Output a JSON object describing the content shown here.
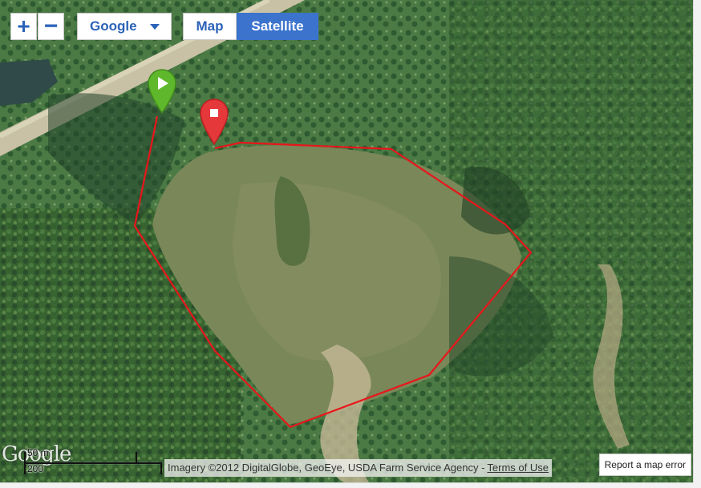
{
  "controls": {
    "zoom_in": "+",
    "zoom_out": "−",
    "provider": "Google",
    "map_label": "Map",
    "satellite_label": "Satellite",
    "active_type": "Satellite"
  },
  "markers": {
    "start": {
      "icon": "play-icon",
      "color": "#5fb82c"
    },
    "end": {
      "icon": "stop-icon",
      "color": "#e5383b"
    }
  },
  "track": {
    "color": "#e8161b"
  },
  "scale": {
    "metric": "50 m",
    "imperial": "200"
  },
  "logo": "Google",
  "attribution": {
    "text": "Imagery ©2012 DigitalGlobe, GeoEye, USDA Farm Service Agency -",
    "terms": "Terms of Use"
  },
  "report_error": "Report a map error",
  "colors": {
    "accent": "#3b73cd",
    "control_text": "#2b62b8",
    "field": "#6f7a4f",
    "forest": "#2f5a2c"
  }
}
